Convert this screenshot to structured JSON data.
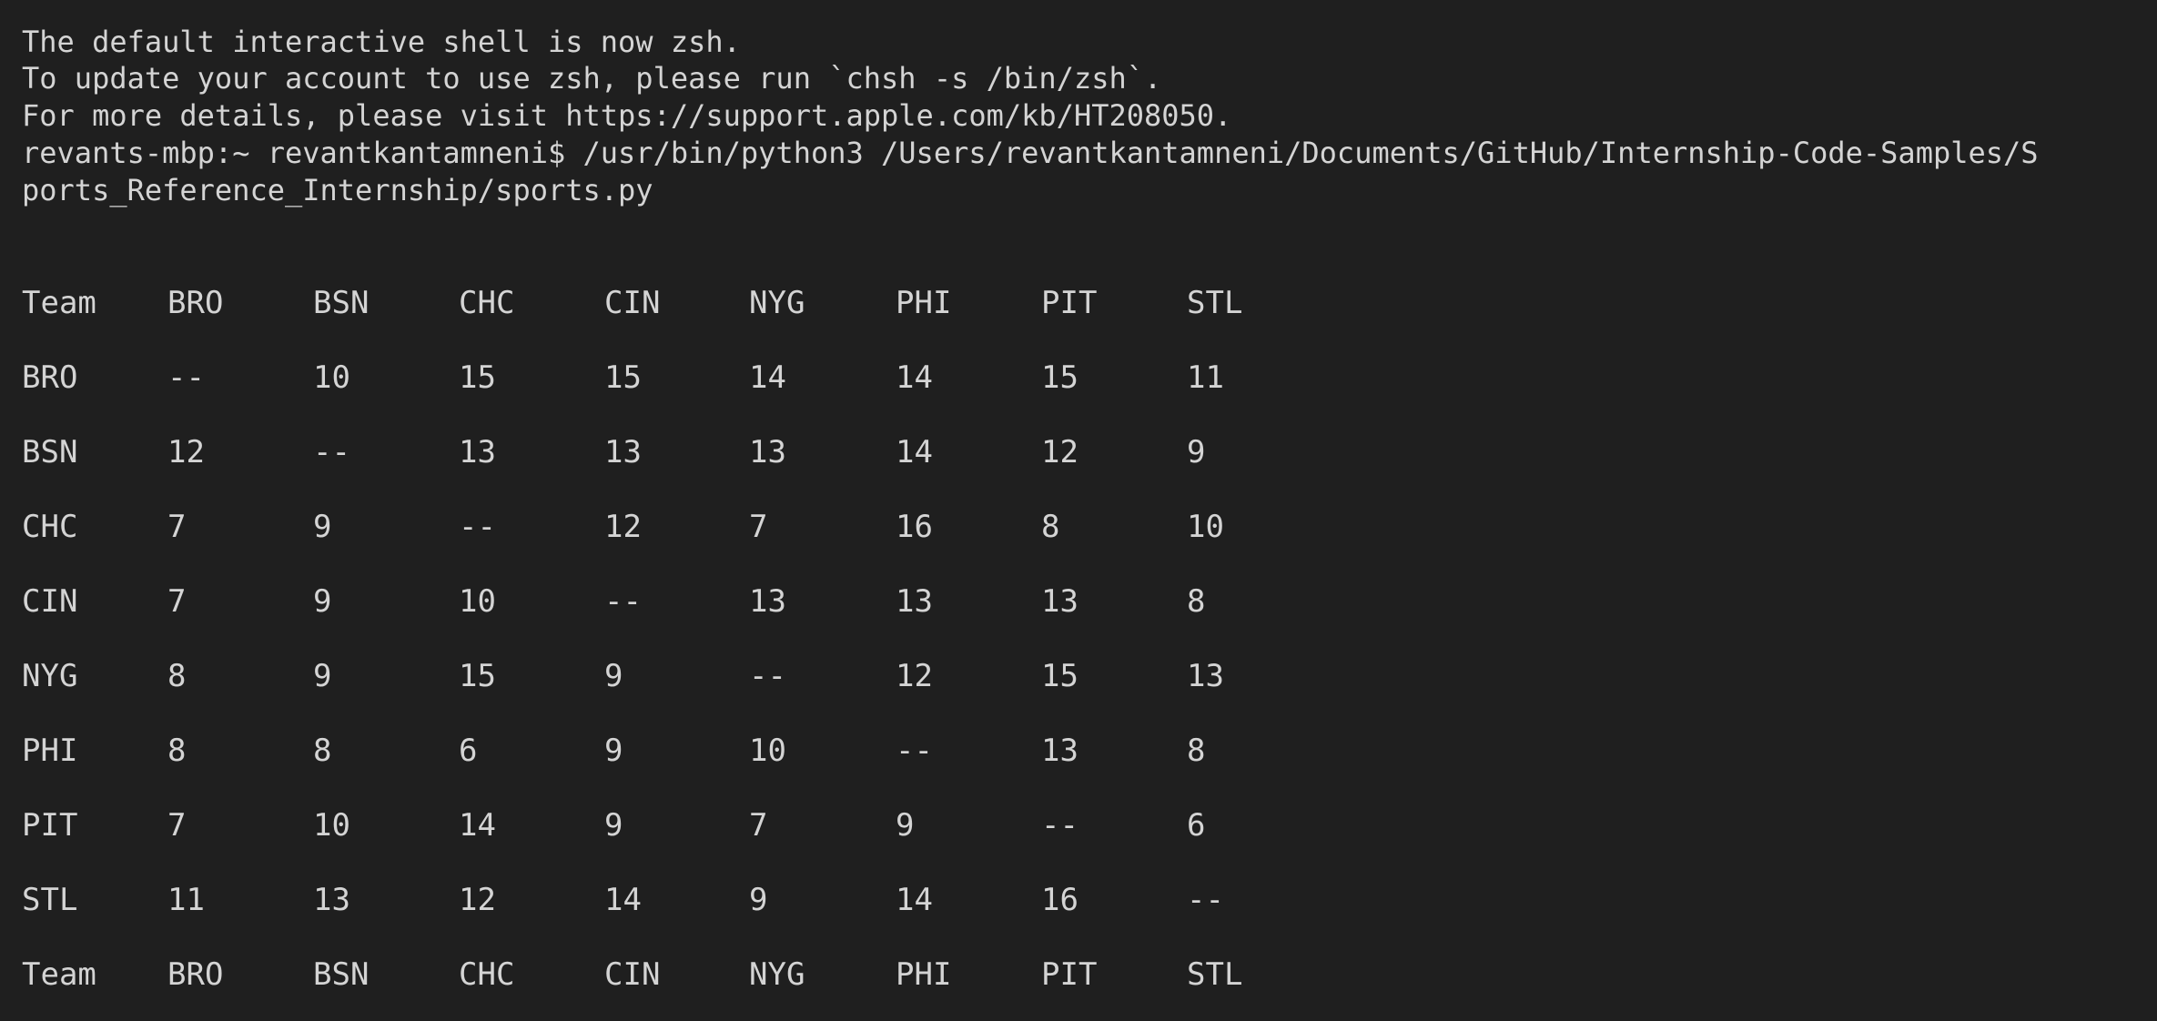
{
  "terminal": {
    "intro_lines": [
      "The default interactive shell is now zsh.",
      "To update your account to use zsh, please run `chsh -s /bin/zsh`.",
      "For more details, please visit https://support.apple.com/kb/HT208050."
    ],
    "prompt_line_1": "revants-mbp:~ revantkantamneni$ /usr/bin/python3 /Users/revantkantamneni/Documents/GitHub/Internship-Code-Samples/S",
    "prompt_line_2": "ports_Reference_Internship/sports.py"
  },
  "table": {
    "header": [
      "Team",
      "BRO",
      "BSN",
      "CHC",
      "CIN",
      "NYG",
      "PHI",
      "PIT",
      "STL"
    ],
    "rows": [
      [
        "BRO",
        "--",
        "10",
        "15",
        "15",
        "14",
        "14",
        "15",
        "11"
      ],
      [
        "BSN",
        "12",
        "--",
        "13",
        "13",
        "13",
        "14",
        "12",
        "9"
      ],
      [
        "CHC",
        "7",
        "9",
        "--",
        "12",
        "7",
        "16",
        "8",
        "10"
      ],
      [
        "CIN",
        "7",
        "9",
        "10",
        "--",
        "13",
        "13",
        "13",
        "8"
      ],
      [
        "NYG",
        "8",
        "9",
        "15",
        "9",
        "--",
        "12",
        "15",
        "13"
      ],
      [
        "PHI",
        "8",
        "8",
        "6",
        "9",
        "10",
        "--",
        "13",
        "8"
      ],
      [
        "PIT",
        "7",
        "10",
        "14",
        "9",
        "7",
        "9",
        "--",
        "6"
      ],
      [
        "STL",
        "11",
        "13",
        "12",
        "14",
        "9",
        "14",
        "16",
        "--"
      ]
    ],
    "footer": [
      "Team",
      "BRO",
      "BSN",
      "CHC",
      "CIN",
      "NYG",
      "PHI",
      "PIT",
      "STL"
    ]
  },
  "colors": {
    "background": "#1f1f1f",
    "text": "#d4d4d4"
  }
}
